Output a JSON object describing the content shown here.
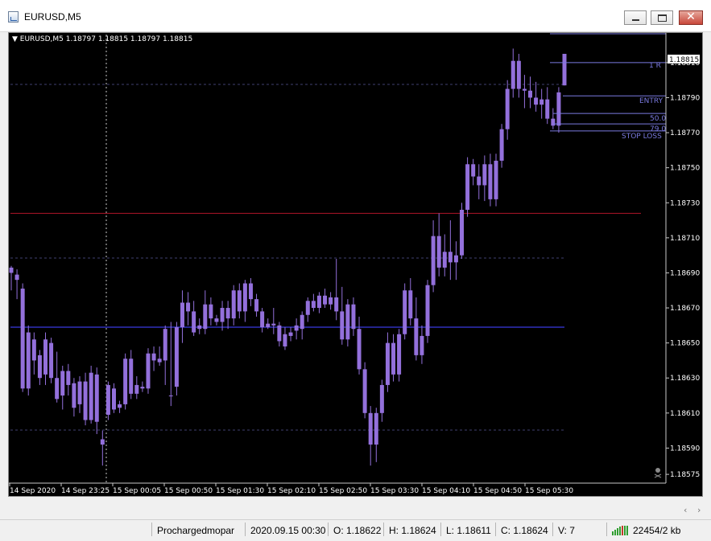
{
  "window": {
    "title": "EURUSD,M5",
    "icon": "chart-window-icon",
    "buttons": [
      "minimize-icon",
      "maximize-icon",
      "close-icon"
    ],
    "close_glyph": "✕"
  },
  "chart": {
    "header": "▼ EURUSD,M5  1.18797 1.18815 1.18797 1.18815",
    "current_price_label": "1.18815",
    "price_ticks": [
      "1.18810",
      "1.18790",
      "1.18770",
      "1.18750",
      "1.18730",
      "1.18710",
      "1.18690",
      "1.18670",
      "1.18650",
      "1.18630",
      "1.18610",
      "1.18590",
      "1.18575"
    ],
    "time_ticks": [
      "14 Sep 2020",
      "14 Sep 23:25",
      "15 Sep 00:05",
      "15 Sep 00:50",
      "15 Sep 01:30",
      "15 Sep 02:10",
      "15 Sep 02:50",
      "15 Sep 03:30",
      "15 Sep 04:10",
      "15 Sep 04:50",
      "15 Sep 05:30"
    ],
    "level_labels": {
      "r1": "1   R",
      "entry": "ENTRY",
      "fib50": "50.0",
      "fib79": "79.0",
      "stop_loss": "STOP LOSS"
    },
    "colors": {
      "background": "#000000",
      "candle": "#9370db",
      "grid": "#404070",
      "red_level": "#b0142a",
      "blue_level": "#24248c",
      "trade_lines": "#7a7ae0",
      "text": "#ffffff"
    }
  },
  "chart_data": {
    "type": "candlestick",
    "symbol": "EURUSD",
    "timeframe": "M5",
    "ylim": [
      1.1857,
      1.18826
    ],
    "last_candle": {
      "open": 1.18797,
      "high": 1.18815,
      "low": 1.18797,
      "close": 1.18815
    },
    "levels": {
      "red_horizontal": 1.18724,
      "blue_horizontal": 1.18659,
      "one_r": 1.1881,
      "entry": 1.18791,
      "fib_50": 1.18781,
      "fib_79": 1.18775,
      "stop_loss": 1.18771
    },
    "candles": [
      [
        1.18693,
        1.18694,
        1.1868,
        1.1869
      ],
      [
        1.18689,
        1.18692,
        1.18675,
        1.18686
      ],
      [
        1.18681,
        1.18684,
        1.18622,
        1.18624
      ],
      [
        1.18624,
        1.1866,
        1.1862,
        1.18656
      ],
      [
        1.18652,
        1.18656,
        1.18632,
        1.1864
      ],
      [
        1.18643,
        1.18646,
        1.18626,
        1.1863
      ],
      [
        1.18632,
        1.18656,
        1.18626,
        1.18652
      ],
      [
        1.1865,
        1.18653,
        1.18627,
        1.1863
      ],
      [
        1.1863,
        1.18645,
        1.18616,
        1.18618
      ],
      [
        1.1862,
        1.18637,
        1.18612,
        1.18634
      ],
      [
        1.18634,
        1.18638,
        1.1862,
        1.18626
      ],
      [
        1.18627,
        1.1863,
        1.18608,
        1.18613
      ],
      [
        1.18615,
        1.18631,
        1.1861,
        1.18628
      ],
      [
        1.18628,
        1.18633,
        1.18603,
        1.18606
      ],
      [
        1.18606,
        1.18637,
        1.18604,
        1.18633
      ],
      [
        1.18632,
        1.18636,
        1.18598,
        1.18605
      ],
      [
        1.18595,
        1.186,
        1.1858,
        1.18592
      ],
      [
        1.18609,
        1.18628,
        1.18606,
        1.18626
      ],
      [
        1.18624,
        1.18627,
        1.1861,
        1.18612
      ],
      [
        1.18613,
        1.18617,
        1.1861,
        1.18615
      ],
      [
        1.18615,
        1.18644,
        1.18612,
        1.18641
      ],
      [
        1.18641,
        1.18646,
        1.18618,
        1.18621
      ],
      [
        1.18621,
        1.18631,
        1.18618,
        1.18626
      ],
      [
        1.18625,
        1.18628,
        1.18622,
        1.18624
      ],
      [
        1.18624,
        1.18647,
        1.18621,
        1.18644
      ],
      [
        1.18644,
        1.18648,
        1.18634,
        1.1864
      ],
      [
        1.18641,
        1.18648,
        1.18637,
        1.18639
      ],
      [
        1.1864,
        1.1866,
        1.18626,
        1.18658
      ],
      [
        1.1862,
        1.18662,
        1.18614,
        1.1862
      ],
      [
        1.18625,
        1.18662,
        1.1862,
        1.18659
      ],
      [
        1.18659,
        1.1868,
        1.1865,
        1.18673
      ],
      [
        1.18673,
        1.18679,
        1.1866,
        1.18668
      ],
      [
        1.18668,
        1.18674,
        1.18654,
        1.18656
      ],
      [
        1.1866,
        1.18664,
        1.18655,
        1.18658
      ],
      [
        1.18658,
        1.1868,
        1.18655,
        1.18672
      ],
      [
        1.18672,
        1.18676,
        1.1866,
        1.18664
      ],
      [
        1.18664,
        1.18666,
        1.1866,
        1.18662
      ],
      [
        1.18662,
        1.18674,
        1.18657,
        1.1867
      ],
      [
        1.1867,
        1.18674,
        1.18658,
        1.18664
      ],
      [
        1.18664,
        1.18683,
        1.1866,
        1.1868
      ],
      [
        1.1868,
        1.18684,
        1.18664,
        1.18668
      ],
      [
        1.18668,
        1.18686,
        1.18662,
        1.18684
      ],
      [
        1.18684,
        1.18687,
        1.18671,
        1.18675
      ],
      [
        1.18675,
        1.18678,
        1.18665,
        1.18668
      ],
      [
        1.18668,
        1.1867,
        1.18656,
        1.18659
      ],
      [
        1.18659,
        1.18664,
        1.18658,
        1.18661
      ],
      [
        1.18661,
        1.1867,
        1.18655,
        1.1866
      ],
      [
        1.1866,
        1.18662,
        1.18648,
        1.18651
      ],
      [
        1.18648,
        1.18659,
        1.18646,
        1.18655
      ],
      [
        1.18654,
        1.18659,
        1.18651,
        1.18656
      ],
      [
        1.18657,
        1.18664,
        1.18652,
        1.1866
      ],
      [
        1.18658,
        1.18668,
        1.18652,
        1.18666
      ],
      [
        1.18666,
        1.18676,
        1.18662,
        1.18674
      ],
      [
        1.18674,
        1.18678,
        1.18668,
        1.1867
      ],
      [
        1.1867,
        1.18679,
        1.18667,
        1.18677
      ],
      [
        1.18677,
        1.18681,
        1.1867,
        1.18672
      ],
      [
        1.18672,
        1.18679,
        1.18669,
        1.18676
      ],
      [
        1.18676,
        1.18698,
        1.18663,
        1.18668
      ],
      [
        1.18668,
        1.18682,
        1.18649,
        1.18652
      ],
      [
        1.18652,
        1.18675,
        1.18648,
        1.18672
      ],
      [
        1.18672,
        1.18676,
        1.18654,
        1.18658
      ],
      [
        1.18658,
        1.18665,
        1.18632,
        1.18635
      ],
      [
        1.18635,
        1.18639,
        1.18607,
        1.1861
      ],
      [
        1.1861,
        1.18614,
        1.1858,
        1.18592
      ],
      [
        1.18592,
        1.18613,
        1.18582,
        1.1861
      ],
      [
        1.1861,
        1.18629,
        1.18605,
        1.18626
      ],
      [
        1.18626,
        1.18656,
        1.18622,
        1.1865
      ],
      [
        1.1865,
        1.18655,
        1.18628,
        1.18632
      ],
      [
        1.18632,
        1.18658,
        1.18628,
        1.18655
      ],
      [
        1.18655,
        1.18684,
        1.18652,
        1.1868
      ],
      [
        1.1868,
        1.18687,
        1.1866,
        1.18664
      ],
      [
        1.18664,
        1.18676,
        1.1864,
        1.18643
      ],
      [
        1.18643,
        1.1866,
        1.18638,
        1.18654
      ],
      [
        1.18654,
        1.18686,
        1.1865,
        1.18683
      ],
      [
        1.18683,
        1.1872,
        1.18679,
        1.18711
      ],
      [
        1.18711,
        1.18724,
        1.18688,
        1.18693
      ],
      [
        1.18693,
        1.18712,
        1.18688,
        1.18702
      ],
      [
        1.18702,
        1.1872,
        1.18686,
        1.18696
      ],
      [
        1.18696,
        1.18708,
        1.18686,
        1.187
      ],
      [
        1.187,
        1.1873,
        1.18698,
        1.18726
      ],
      [
        1.18726,
        1.18756,
        1.18722,
        1.18752
      ],
      [
        1.18752,
        1.18755,
        1.1874,
        1.18745
      ],
      [
        1.18745,
        1.18752,
        1.18732,
        1.1874
      ],
      [
        1.1874,
        1.18757,
        1.18731,
        1.18752
      ],
      [
        1.18752,
        1.18758,
        1.18728,
        1.18732
      ],
      [
        1.18732,
        1.18758,
        1.18728,
        1.18754
      ],
      [
        1.18754,
        1.18775,
        1.1875,
        1.18772
      ],
      [
        1.18772,
        1.188,
        1.18766,
        1.18795
      ],
      [
        1.18795,
        1.18818,
        1.1879,
        1.18811
      ],
      [
        1.18811,
        1.18815,
        1.1879,
        1.18795
      ],
      [
        1.18795,
        1.18803,
        1.18784,
        1.18794
      ],
      [
        1.18794,
        1.18802,
        1.18784,
        1.1879
      ],
      [
        1.1879,
        1.18799,
        1.18782,
        1.18786
      ],
      [
        1.18786,
        1.18795,
        1.18778,
        1.18789
      ],
      [
        1.18789,
        1.18796,
        1.18775,
        1.18778
      ],
      [
        1.18778,
        1.18784,
        1.18772,
        1.18774
      ],
      [
        1.18774,
        1.18796,
        1.1877,
        1.18793
      ],
      [
        1.18797,
        1.18815,
        1.18797,
        1.18815
      ]
    ]
  },
  "statusbar": {
    "profile": "Prochargedmopar",
    "datetime": "2020.09.15 00:30",
    "open": "O: 1.18622",
    "high": "H: 1.18624",
    "low": "L: 1.18611",
    "close": "C: 1.18624",
    "volume": "V: 7",
    "traffic": "22454/2 kb"
  },
  "scroll": {
    "left_glyph": "‹",
    "right_glyph": "›"
  }
}
